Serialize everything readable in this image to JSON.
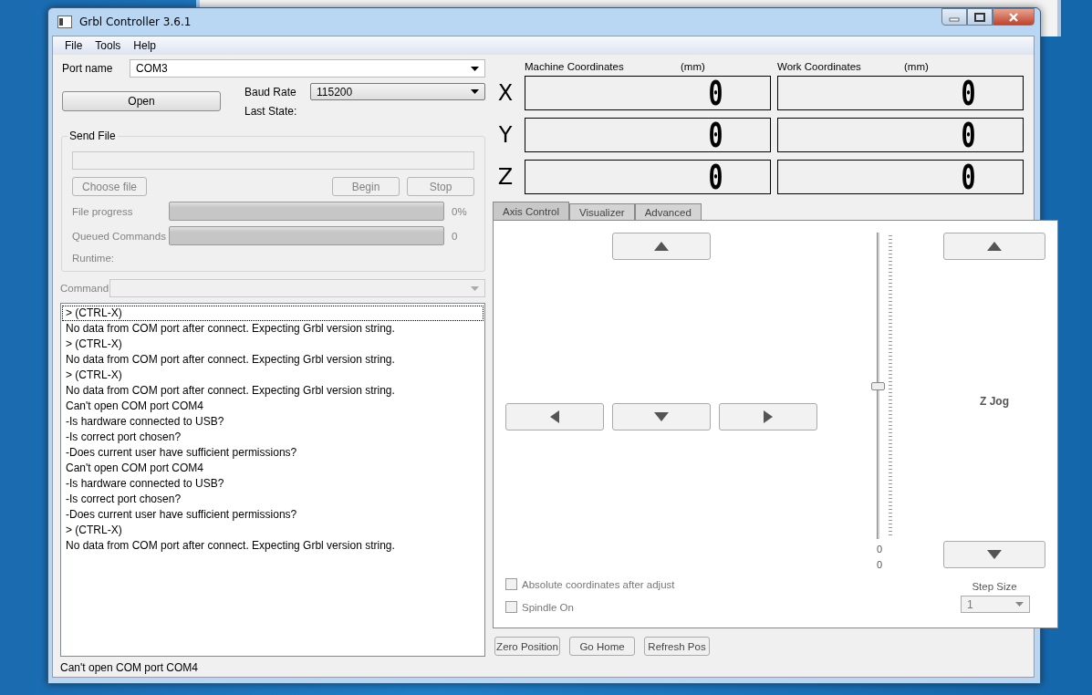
{
  "window": {
    "title": "Grbl Controller 3.6.1"
  },
  "menu": [
    {
      "label": "File"
    },
    {
      "label": "Tools"
    },
    {
      "label": "Help"
    }
  ],
  "port": {
    "label": "Port name",
    "value": "COM3"
  },
  "open_button": {
    "label": "Open"
  },
  "baud": {
    "label": "Baud Rate",
    "value": "115200"
  },
  "last_state": {
    "label": "Last State:"
  },
  "send_file": {
    "title": "Send File",
    "disabled": true,
    "buttons": [
      {
        "label": "Choose file"
      },
      {
        "label": "Begin"
      },
      {
        "label": "Stop"
      }
    ],
    "progress": [
      {
        "label": "File progress",
        "level": 0,
        "reading": "0%"
      },
      {
        "label": "Queued Commands",
        "level": 0,
        "reading": "0"
      }
    ],
    "runtime": "Runtime:"
  },
  "command": {
    "label": "Command",
    "disabled": true
  },
  "console": {
    "lines": [
      "> (CTRL-X)",
      "No data from COM port after connect. Expecting Grbl version string.",
      "> (CTRL-X)",
      "No data from COM port after connect. Expecting Grbl version string.",
      "> (CTRL-X)",
      "No data from COM port after connect. Expecting Grbl version string.",
      "Can't open COM port COM4",
      "-Is hardware connected to USB?",
      "-Is correct port chosen?",
      "-Does current user have sufficient permissions?",
      "Can't open COM port COM4",
      "-Is hardware connected to USB?",
      "-Is correct port chosen?",
      "-Does current user have sufficient permissions?",
      "> (CTRL-X)",
      "No data from COM port after connect. Expecting Grbl version string."
    ]
  },
  "status_bar": {
    "text": "Can't open COM port COM4"
  },
  "coordinates": {
    "machine": {
      "title": "Machine Coordinates",
      "unit": "(mm)"
    },
    "work": {
      "title": "Work Coordinates",
      "unit": "(mm)"
    },
    "axes": [
      {
        "axis": "X",
        "machine": "0",
        "work": "0"
      },
      {
        "axis": "Y",
        "machine": "0",
        "work": "0"
      },
      {
        "axis": "Z",
        "machine": "0",
        "work": "0"
      }
    ]
  },
  "tabs": [
    {
      "label": "Axis Control",
      "selected": true
    },
    {
      "label": "Visualizer",
      "selected": false
    },
    {
      "label": "Advanced",
      "selected": false
    }
  ],
  "axis_control": {
    "z_slider": {
      "level": 0.5
    },
    "readings": [
      "0",
      "0"
    ],
    "z_jog_label": "Z Jog",
    "checkboxes": [
      {
        "label": "Absolute coordinates after adjust",
        "checked": false,
        "disabled": true
      },
      {
        "label": "Spindle On",
        "checked": false,
        "disabled": true
      }
    ],
    "step_size": {
      "label": "Step Size",
      "value": "1",
      "disabled": true
    }
  },
  "bottom_buttons": [
    {
      "label": "Zero Position"
    },
    {
      "label": "Go Home"
    },
    {
      "label": "Refresh Pos"
    }
  ]
}
